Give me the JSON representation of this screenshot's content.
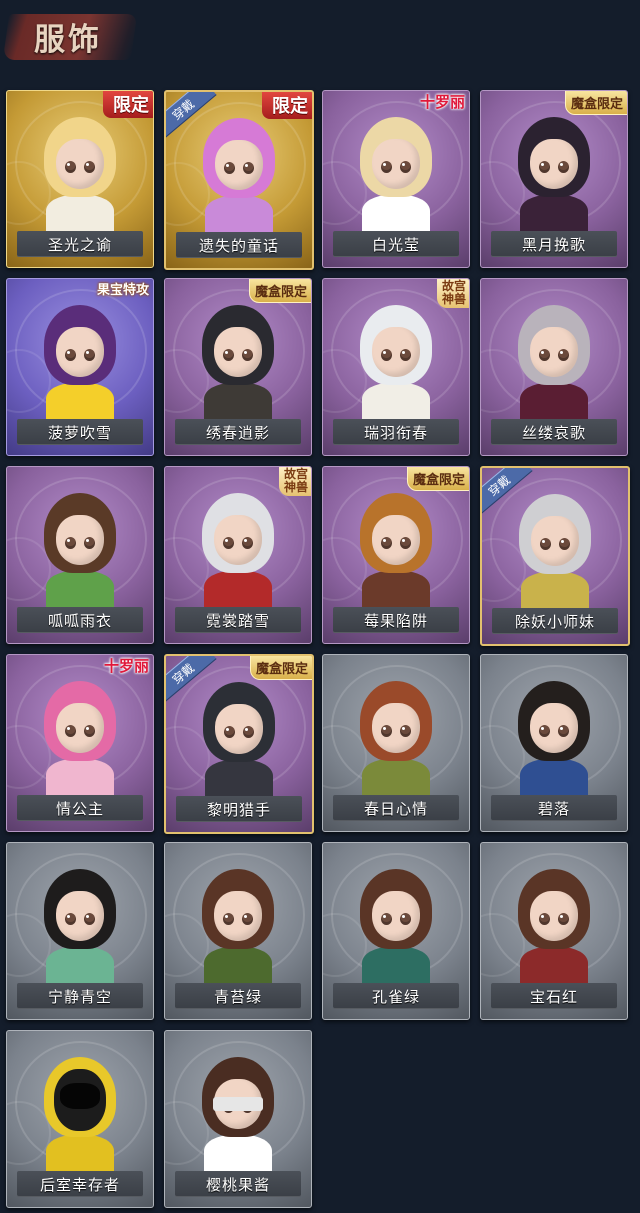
{
  "header": {
    "title": "服饰"
  },
  "cards": [
    {
      "name": "圣光之谕",
      "frame": "gold",
      "badge": "限定",
      "badge_style": "limited",
      "equipped": false,
      "hair": "#f1d58a",
      "body": "#f2ede0"
    },
    {
      "name": "遗失的童话",
      "frame": "gold",
      "badge": "限定",
      "badge_style": "limited",
      "equipped": true,
      "equip_label": "穿戴",
      "hair": "#d67ad6",
      "body": "#c98ad9"
    },
    {
      "name": "白光莹",
      "frame": "purple",
      "badge": "十罗丽",
      "badge_style": "luoli",
      "equipped": false,
      "hair": "#ecd8a6",
      "body": "#ffffff"
    },
    {
      "name": "黑月挽歌",
      "frame": "purple",
      "badge": "魔盒限定",
      "badge_style": "mohe",
      "equipped": false,
      "hair": "#2b2230",
      "body": "#3a2238"
    },
    {
      "name": "菠萝吹雪",
      "frame": "bluepurple",
      "badge": "果宝特攻",
      "badge_style": "guobao",
      "equipped": false,
      "hair": "#5a2d7a",
      "body": "#f4cf2a"
    },
    {
      "name": "绣春逍影",
      "frame": "purple",
      "badge": "魔盒限定",
      "badge_style": "mohe",
      "equipped": false,
      "hair": "#2a2a30",
      "body": "#3e3a36"
    },
    {
      "name": "瑞羽衔春",
      "frame": "purple",
      "badge": "故宫\n神兽",
      "badge_style": "gugong",
      "equipped": false,
      "hair": "#e9ecef",
      "body": "#f1eee6"
    },
    {
      "name": "丝缕哀歌",
      "frame": "purple",
      "badge": "",
      "badge_style": "",
      "equipped": false,
      "hair": "#b9b3bb",
      "body": "#5a1e33"
    },
    {
      "name": "呱呱雨衣",
      "frame": "purple",
      "badge": "",
      "badge_style": "",
      "equipped": false,
      "hair": "#5a3a27",
      "body": "#5fa14a"
    },
    {
      "name": "霓裳踏雪",
      "frame": "purple",
      "badge": "故宫\n神兽",
      "badge_style": "gugong",
      "equipped": false,
      "hair": "#dfe0e4",
      "body": "#b32a2a"
    },
    {
      "name": "莓果陷阱",
      "frame": "purple",
      "badge": "魔盒限定",
      "badge_style": "mohe",
      "equipped": false,
      "hair": "#b8732b",
      "body": "#6b3a2a"
    },
    {
      "name": "除妖小师妹",
      "frame": "purple",
      "badge": "",
      "badge_style": "",
      "equipped": true,
      "equip_label": "穿戴",
      "hair": "#cfcfd2",
      "body": "#c9b24b"
    },
    {
      "name": "情公主",
      "frame": "purple",
      "badge": "十罗丽",
      "badge_style": "luoli",
      "equipped": false,
      "hair": "#e46aa6",
      "body": "#f0b6cf"
    },
    {
      "name": "黎明猎手",
      "frame": "purple",
      "badge": "魔盒限定",
      "badge_style": "mohe",
      "equipped": true,
      "equip_label": "穿戴",
      "hair": "#2c2f36",
      "body": "#35363f"
    },
    {
      "name": "春日心情",
      "frame": "grey",
      "badge": "",
      "badge_style": "",
      "equipped": false,
      "hair": "#9a4a2a",
      "body": "#7b8a3a"
    },
    {
      "name": "碧落",
      "frame": "grey",
      "badge": "",
      "badge_style": "",
      "equipped": false,
      "hair": "#241f1d",
      "body": "#2f4f92"
    },
    {
      "name": "宁静青空",
      "frame": "grey",
      "badge": "",
      "badge_style": "",
      "equipped": false,
      "hair": "#1e1c1c",
      "body": "#6bb493"
    },
    {
      "name": "青苔绿",
      "frame": "grey",
      "badge": "",
      "badge_style": "",
      "equipped": false,
      "hair": "#5a3526",
      "body": "#4d6a2e"
    },
    {
      "name": "孔雀绿",
      "frame": "grey",
      "badge": "",
      "badge_style": "",
      "equipped": false,
      "hair": "#5a3526",
      "body": "#2d6e62"
    },
    {
      "name": "宝石红",
      "frame": "grey",
      "badge": "",
      "badge_style": "",
      "equipped": false,
      "hair": "#5a3526",
      "body": "#8c2a2a"
    },
    {
      "name": "后室幸存者",
      "frame": "grey",
      "badge": "",
      "badge_style": "",
      "equipped": false,
      "hair": "#e8c82a",
      "body": "#e2c020",
      "special": "mask"
    },
    {
      "name": "樱桃果酱",
      "frame": "grey",
      "badge": "",
      "badge_style": "",
      "equipped": false,
      "hair": "#4a2d22",
      "body": "#ffffff",
      "special": "blindfold"
    }
  ]
}
